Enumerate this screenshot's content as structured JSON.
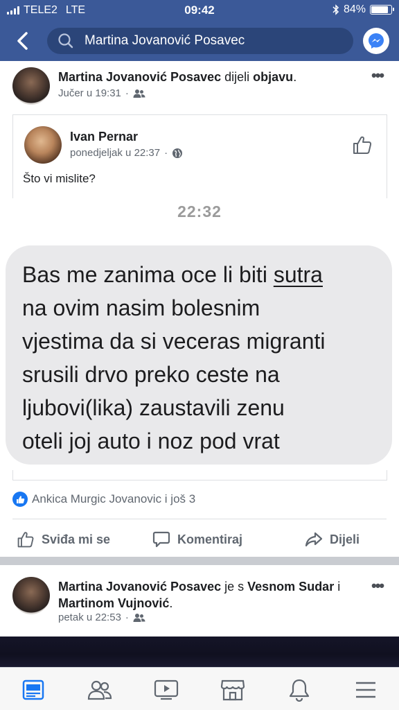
{
  "status_bar": {
    "carrier": "TELE2",
    "network": "LTE",
    "time": "09:42",
    "battery_percent": "84%",
    "battery_level": 0.84
  },
  "nav": {
    "search_text": "Martina Jovanović Posavec"
  },
  "post1": {
    "author": "Martina Jovanović Posavec",
    "action_text": "dijeli",
    "action_link": "objavu",
    "time": "Jučer u 19:31",
    "shared": {
      "author": "Ivan Pernar",
      "time": "ponedjeljak u 22:37",
      "text": "Što vi mislite?",
      "sms_time": "22:32",
      "message_lines": [
        "Bas me zanima oce li biti ",
        "sutra",
        "na ovim nasim bolesnim",
        "vjestima da si veceras migranti",
        "srusili drvo preko ceste na",
        "ljubovi(lika) zaustavili zenu",
        "oteli joj auto i noz pod vrat"
      ]
    },
    "reactions_text": "Ankica Murgic Jovanovic i još 3",
    "actions": {
      "like": "Sviđa mi se",
      "comment": "Komentiraj",
      "share": "Dijeli"
    }
  },
  "post2": {
    "author": "Martina Jovanović Posavec",
    "with_word": "je s",
    "tagged1": "Vesnom Sudar",
    "and_word": "i",
    "tagged2": "Martinom Vujnović",
    "time": "petak u 22:53"
  },
  "colors": {
    "brand": "#3b5998",
    "like_blue": "#1877f2"
  },
  "icons": [
    "back-arrow-icon",
    "search-icon",
    "messenger-icon",
    "friends-icon",
    "globe-icon",
    "thumbs-up-icon",
    "comment-icon",
    "share-icon",
    "feed-icon",
    "friends-tab-icon",
    "video-icon",
    "marketplace-icon",
    "bell-icon",
    "menu-icon"
  ]
}
